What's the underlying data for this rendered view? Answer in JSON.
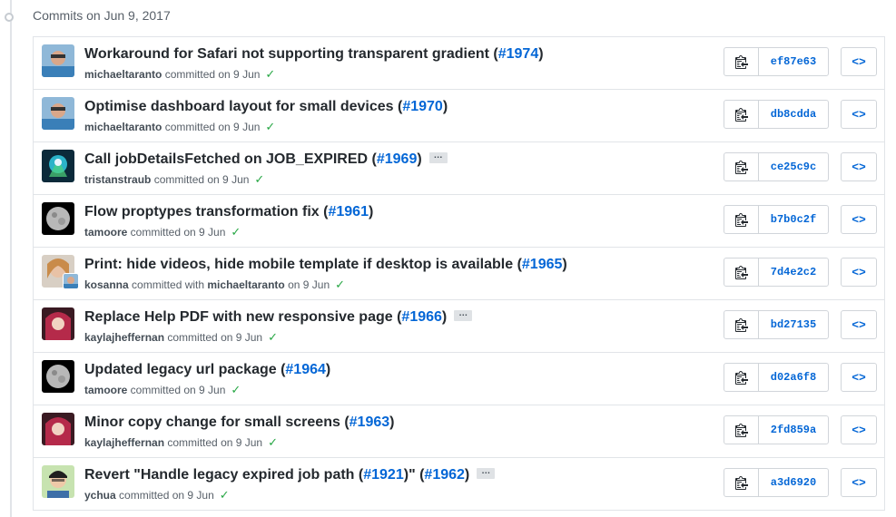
{
  "header": {
    "title": "Commits on Jun 9, 2017"
  },
  "colors": {
    "link": "#0366d6",
    "check": "#28a745",
    "muted": "#586069"
  },
  "icons": {
    "copy": "clippy-icon",
    "browse": "code-icon",
    "status": "check-icon",
    "more": "ellipsis-icon"
  },
  "commits": [
    {
      "title": "Workaround for Safari not supporting transparent gradient (",
      "pr": "#1974",
      "title_end": ")",
      "author": "michaeltaranto",
      "meta": " committed on 9 Jun",
      "coauthor_prefix": "",
      "coauthor": "",
      "check": "✓",
      "sha": "ef87e63",
      "browse": "<>"
    },
    {
      "title": "Optimise dashboard layout for small devices (",
      "pr": "#1970",
      "title_end": ")",
      "author": "michaeltaranto",
      "meta": " committed on 9 Jun",
      "coauthor_prefix": "",
      "coauthor": "",
      "check": "✓",
      "sha": "db8cdda",
      "browse": "<>"
    },
    {
      "title": "Call jobDetailsFetched on JOB_EXPIRED (",
      "pr": "#1969",
      "title_end": ")",
      "ellipsis": "…",
      "author": "tristanstraub",
      "meta": " committed on 9 Jun",
      "coauthor_prefix": "",
      "coauthor": "",
      "check": "✓",
      "sha": "ce25c9c",
      "browse": "<>"
    },
    {
      "title": "Flow proptypes transformation fix (",
      "pr": "#1961",
      "title_end": ")",
      "author": "tamoore",
      "meta": " committed on 9 Jun",
      "coauthor_prefix": "",
      "coauthor": "",
      "check": "✓",
      "sha": "b7b0c2f",
      "browse": "<>"
    },
    {
      "title": "Print: hide videos, hide mobile template if desktop is available (",
      "pr": "#1965",
      "title_end": ")",
      "author": "kosanna",
      "coauthor_prefix": " committed with ",
      "coauthor": "michaeltaranto",
      "meta": " on 9 Jun",
      "check": "✓",
      "sha": "7d4e2c2",
      "browse": "<>"
    },
    {
      "title": "Replace Help PDF with new responsive page (",
      "pr": "#1966",
      "title_end": ")",
      "ellipsis": "…",
      "author": "kaylajheffernan",
      "meta": " committed on 9 Jun",
      "coauthor_prefix": "",
      "coauthor": "",
      "check": "✓",
      "sha": "bd27135",
      "browse": "<>"
    },
    {
      "title": "Updated legacy url package (",
      "pr": "#1964",
      "title_end": ")",
      "author": "tamoore",
      "meta": " committed on 9 Jun",
      "coauthor_prefix": "",
      "coauthor": "",
      "check": "✓",
      "sha": "d02a6f8",
      "browse": "<>"
    },
    {
      "title": "Minor copy change for small screens (",
      "pr": "#1963",
      "title_end": ")",
      "author": "kaylajheffernan",
      "meta": " committed on 9 Jun",
      "coauthor_prefix": "",
      "coauthor": "",
      "check": "✓",
      "sha": "2fd859a",
      "browse": "<>"
    },
    {
      "title": "Revert \"Handle legacy expired job path (",
      "pr": "#1921",
      "title_mid": ")\" (",
      "pr2": "#1962",
      "title_end": ")",
      "ellipsis": "…",
      "author": "ychua",
      "meta": " committed on 9 Jun",
      "coauthor_prefix": "",
      "coauthor": "",
      "check": "✓",
      "sha": "a3d6920",
      "browse": "<>"
    }
  ]
}
